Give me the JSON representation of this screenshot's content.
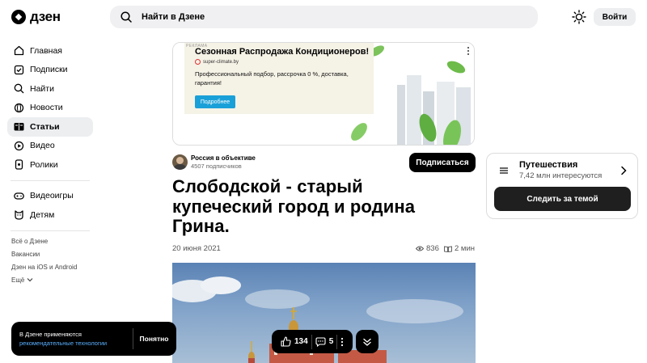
{
  "header": {
    "logo_text": "дзен",
    "search_placeholder": "Найти в Дзене",
    "login_label": "Войти",
    "theme_icon": "sun-icon"
  },
  "sidebar": {
    "items": [
      {
        "label": "Главная",
        "icon": "home-icon"
      },
      {
        "label": "Подписки",
        "icon": "subscriptions-icon"
      },
      {
        "label": "Найти",
        "icon": "search-icon"
      },
      {
        "label": "Новости",
        "icon": "globe-icon"
      },
      {
        "label": "Статьи",
        "icon": "book-icon",
        "active": true
      },
      {
        "label": "Видео",
        "icon": "play-icon"
      },
      {
        "label": "Ролики",
        "icon": "clips-icon"
      }
    ],
    "secondary": [
      {
        "label": "Видеоигры",
        "icon": "gamepad-icon"
      },
      {
        "label": "Детям",
        "icon": "kids-icon"
      }
    ],
    "footer_links": [
      "Всё о Дзене",
      "Вакансии",
      "Дзен на iOS и Android",
      "Ещё"
    ]
  },
  "ad": {
    "label": "РЕКЛАМА",
    "title": "Сезонная Распродажа Кондиционеров!",
    "domain": "super-climate.by",
    "text": "Профессиональный подбор, рассрочка 0 %, доставка, гарантия!",
    "button": "Подробнее"
  },
  "channel": {
    "name": "Россия в объективе",
    "subscribers": "4507 подписчиков",
    "subscribe_label": "Подписаться"
  },
  "article": {
    "title": "Слободской - старый купеческий город и родина Грина.",
    "date": "20 июня 2021",
    "views": "836",
    "read_time": "2 мин"
  },
  "actions": {
    "likes": "134",
    "comments": "5"
  },
  "topic": {
    "name": "Путешествия",
    "interested": "7,42 млн интересуются",
    "follow_label": "Следить за темой"
  },
  "cookie": {
    "text": "В Дзене применяются",
    "link": "рекомендательные технологии",
    "button": "Понятно"
  }
}
